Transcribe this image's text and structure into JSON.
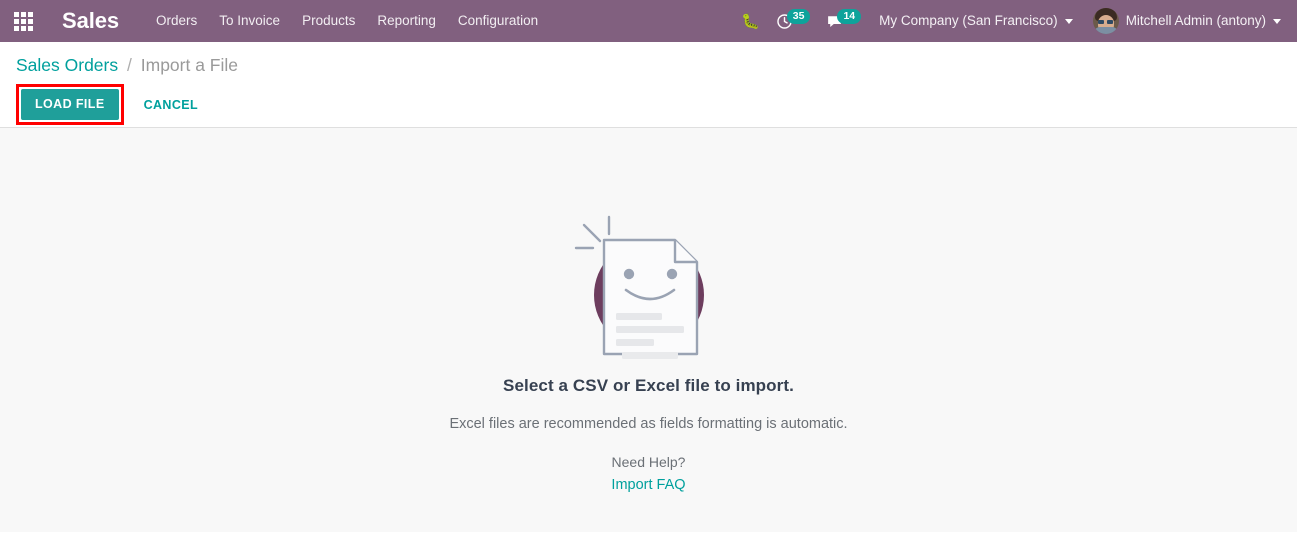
{
  "navbar": {
    "apps_icon": "apps-grid-icon",
    "brand": "Sales",
    "menu": [
      {
        "label": "Orders"
      },
      {
        "label": "To Invoice"
      },
      {
        "label": "Products"
      },
      {
        "label": "Reporting"
      },
      {
        "label": "Configuration"
      }
    ],
    "debug_icon": "bug-icon",
    "activities": {
      "icon": "clock-icon",
      "count": "35"
    },
    "messages": {
      "icon": "chat-icon",
      "count": "14"
    },
    "company": "My Company (San Francisco)",
    "user": "Mitchell Admin (antony)",
    "accent": "#81607f",
    "badge_color": "#0ea39b"
  },
  "control_panel": {
    "breadcrumb": {
      "parent": "Sales Orders",
      "separator": "/",
      "current": "Import a File"
    },
    "load_file_label": "LOAD FILE",
    "cancel_label": "CANCEL",
    "highlight_color": "#ff0000",
    "primary_color": "#1f9f9a"
  },
  "main": {
    "illustration": "document-smiley-illustration",
    "headline": "Select a CSV or Excel file to import.",
    "subline": "Excel files are recommended as fields formatting is automatic.",
    "help_label": "Need Help?",
    "faq_link": "Import FAQ",
    "link_color": "#00a09d"
  }
}
